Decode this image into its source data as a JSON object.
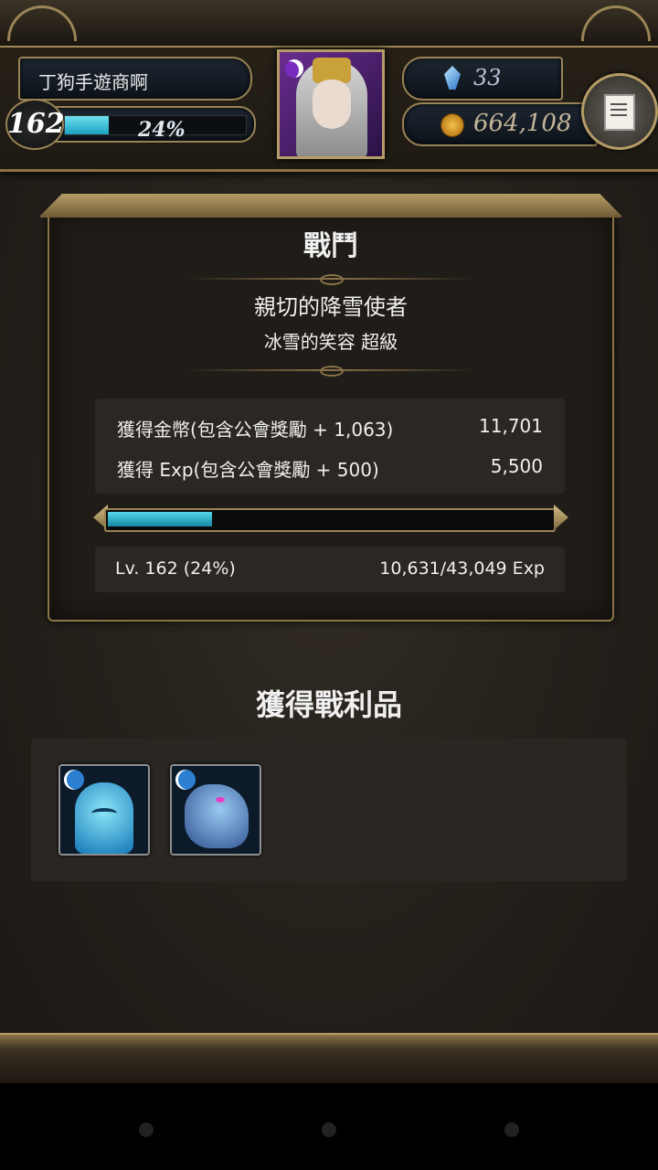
{
  "header": {
    "player_name": "丁狗手遊商啊",
    "level": "162",
    "exp_percent_text": "24%",
    "exp_fraction": 0.24,
    "gems": "33",
    "coins": "664,108",
    "icons": {
      "gem": "crystal-icon",
      "coin": "coin-icon",
      "menu": "menu-document-icon"
    }
  },
  "battle": {
    "title": "戰鬥",
    "stage_name": "親切的降雪使者",
    "stage_subtitle": "冰雪的笑容 超級",
    "rewards": [
      {
        "label": "獲得金幣(包含公會獎勵 + 1,063)",
        "value": "11,701"
      },
      {
        "label": "獲得 Exp(包含公會獎勵 + 500)",
        "value": "5,500"
      }
    ],
    "exp_bar_fraction": 0.24,
    "level_text": "Lv. 162 (24%)",
    "exp_text": "10,631/43,049 Exp"
  },
  "loot": {
    "title": "獲得戰利品",
    "cards": [
      {
        "name": "water-slime-card",
        "attribute": "water"
      },
      {
        "name": "water-fairy-card",
        "attribute": "water"
      }
    ]
  },
  "colors": {
    "accent_gold": "#b59c67",
    "exp_cyan": "#1aa0c0",
    "panel_bg": "#201c17"
  }
}
